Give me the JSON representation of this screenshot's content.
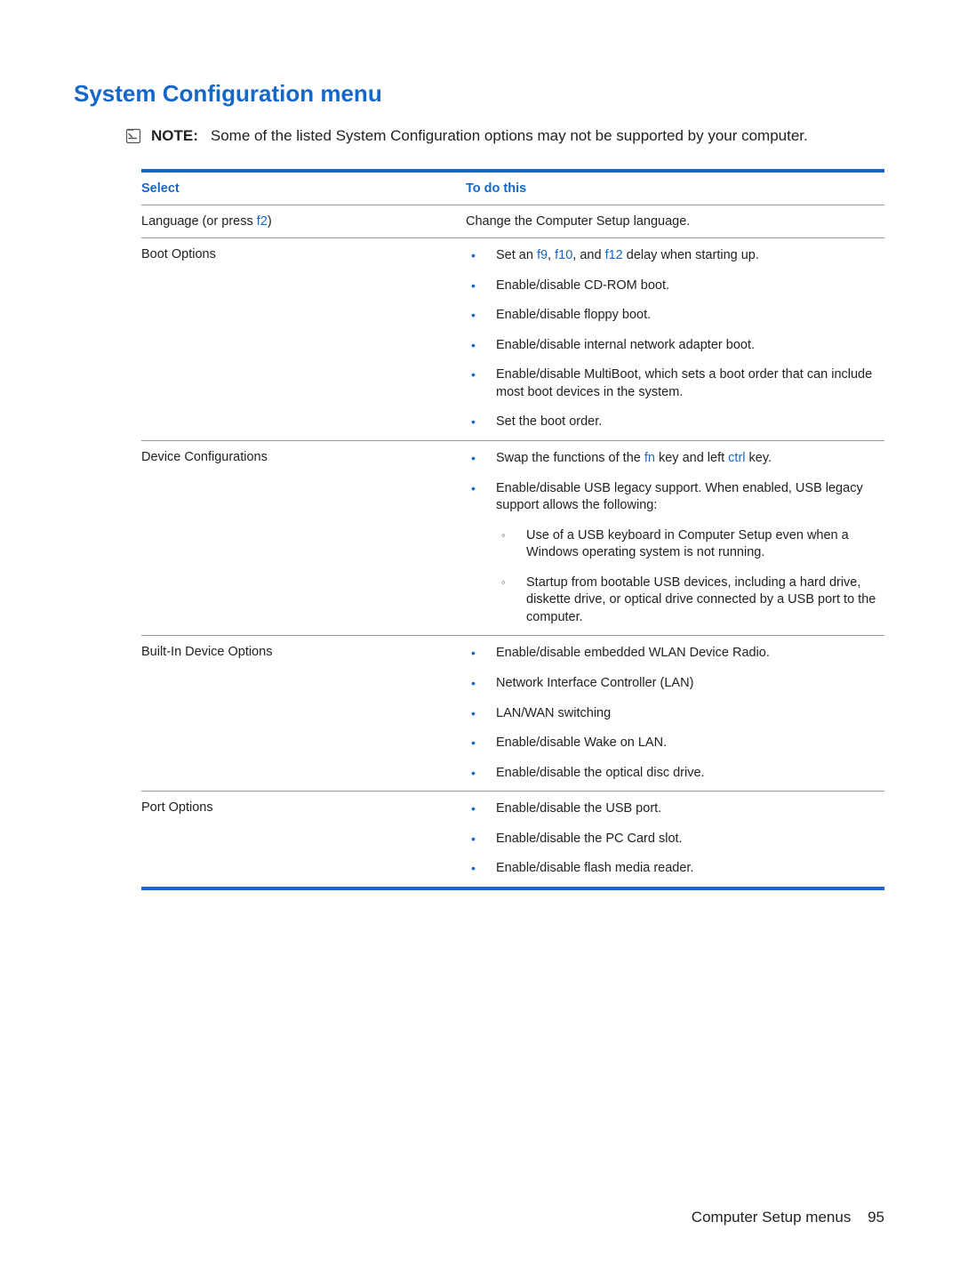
{
  "heading": "System Configuration menu",
  "note": {
    "label": "NOTE:",
    "text": "Some of the listed System Configuration options may not be supported by your computer."
  },
  "table": {
    "headers": {
      "col1": "Select",
      "col2": "To do this"
    },
    "rows": [
      {
        "select_pre": "Language (or press ",
        "select_kbd": "f2",
        "select_post": ")",
        "type": "plain",
        "desc": "Change the Computer Setup language."
      },
      {
        "select": "Boot Options",
        "type": "list",
        "items": [
          {
            "pre": "Set an ",
            "kbds": [
              "f9",
              "f10",
              "f12"
            ],
            "joins": [
              ", ",
              ", and "
            ],
            "post": " delay when starting up."
          },
          {
            "text": "Enable/disable CD-ROM boot."
          },
          {
            "text": "Enable/disable floppy boot."
          },
          {
            "text": "Enable/disable internal network adapter boot."
          },
          {
            "text": "Enable/disable MultiBoot, which sets a boot order that can include most boot devices in the system."
          },
          {
            "text": "Set the boot order."
          }
        ]
      },
      {
        "select": "Device Configurations",
        "type": "list",
        "items": [
          {
            "pre": "Swap the functions of the ",
            "kbds": [
              "fn",
              "ctrl"
            ],
            "joins_mid": " key and left ",
            "post": " key."
          },
          {
            "text": "Enable/disable USB legacy support. When enabled, USB legacy support allows the following:",
            "sub": [
              "Use of a USB keyboard in Computer Setup even when a Windows operating system is not running.",
              "Startup from bootable USB devices, including a hard drive, diskette drive, or optical drive connected by a USB port to the computer."
            ]
          }
        ]
      },
      {
        "select": "Built-In Device Options",
        "type": "list",
        "items": [
          {
            "text": "Enable/disable embedded WLAN Device Radio."
          },
          {
            "text": "Network Interface Controller (LAN)"
          },
          {
            "text": "LAN/WAN switching"
          },
          {
            "text": "Enable/disable Wake on LAN."
          },
          {
            "text": "Enable/disable the optical disc drive."
          }
        ]
      },
      {
        "select": "Port Options",
        "type": "list",
        "items": [
          {
            "text": "Enable/disable the USB port."
          },
          {
            "text": "Enable/disable the PC Card slot."
          },
          {
            "text": "Enable/disable flash media reader."
          }
        ]
      }
    ]
  },
  "footer": {
    "text": "Computer Setup menus",
    "page": "95"
  }
}
